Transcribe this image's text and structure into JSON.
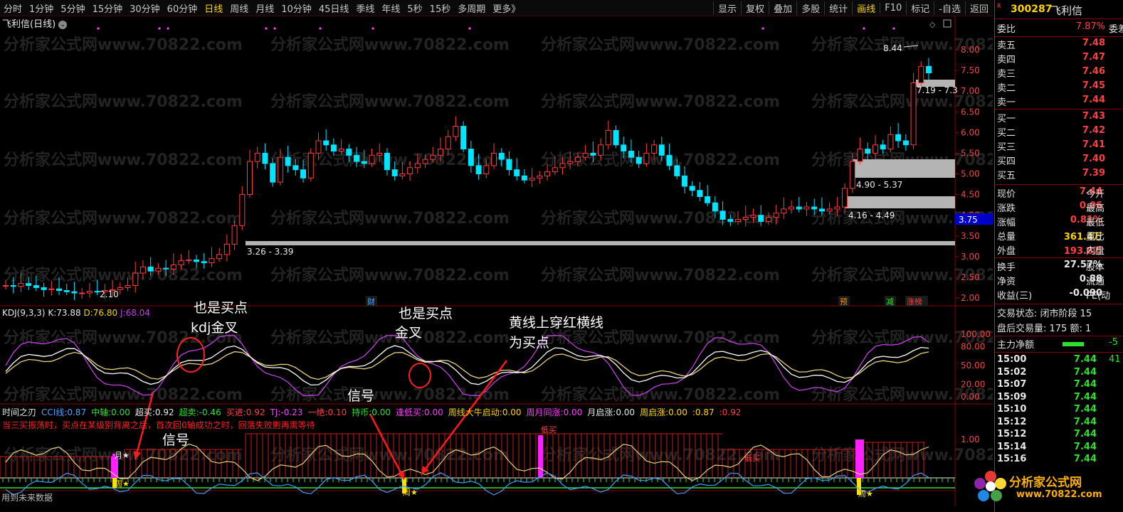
{
  "toolbar": {
    "periods": [
      "分时",
      "1分钟",
      "5分钟",
      "15分钟",
      "30分钟",
      "60分钟",
      "日线",
      "周线",
      "月线",
      "10分钟",
      "45日线",
      "季线",
      "年线",
      "5秒",
      "15秒",
      "多周期",
      "更多》"
    ],
    "active_period": "日线",
    "tools": [
      "显示",
      "复权",
      "叠加",
      "多股",
      "统计",
      "画线",
      "F10",
      "标记",
      "-自选",
      "返回"
    ],
    "active_tool": "画线"
  },
  "stock": {
    "code": "300287",
    "name": "飞利信",
    "title": "飞利信(日线)",
    "r_badge": "R"
  },
  "price_axis": [
    "8.00",
    "7.50",
    "7.00",
    "6.50",
    "6.00",
    "5.50",
    "5.00",
    "4.50",
    "4.00",
    "3.50",
    "3.00",
    "2.50",
    "2.00"
  ],
  "price_marks": {
    "high": "8.44",
    "low": "2.10",
    "current_tag": "3.75"
  },
  "zones": [
    "7.19 - 7.3",
    "4.90 - 5.37",
    "4.16 - 4.49",
    "3.26 - 3.39"
  ],
  "event_tags": [
    {
      "text": "财",
      "color": "#4da3ff"
    },
    {
      "text": "预",
      "color": "#ff8c00"
    },
    {
      "text": "减",
      "color": "#30e030"
    },
    {
      "text": "涨榜",
      "color": "#ff4040"
    }
  ],
  "watermark": "分析家公式网www.70822.com",
  "kdj": {
    "name": "KDJ(9,3,3)",
    "k_label": "K:",
    "k": "73.88",
    "d_label": "D:",
    "d": "76.80",
    "j_label": "J:",
    "j": "68.04",
    "axis": [
      "100.00",
      "80.00",
      "50.00",
      "20.00",
      "0.00"
    ]
  },
  "ind3": {
    "name": "时间之刃",
    "items": [
      {
        "label": "CCI线:",
        "value": "0.87",
        "color": "#4da3ff"
      },
      {
        "label": "中轴:",
        "value": "0.00",
        "color": "#30e030"
      },
      {
        "label": "超买:",
        "value": "0.92",
        "color": "#e8e8e8"
      },
      {
        "label": "超卖:",
        "value": "-0.46",
        "color": "#30e030"
      },
      {
        "label": "买进:",
        "value": "0.92",
        "color": "#ff4040"
      },
      {
        "label": "TJ:",
        "value": "-0.23",
        "color": "#ff40ff"
      },
      {
        "label": "一绝:",
        "value": "0.10",
        "color": "#ff4040"
      },
      {
        "label": "持币:",
        "value": "0.00",
        "color": "#30e030"
      },
      {
        "label": "逢低买:",
        "value": "0.00",
        "color": "#ff40ff"
      },
      {
        "label": "周线大牛启动:",
        "value": "0.00",
        "color": "#ffd400"
      },
      {
        "label": "周月同涨:",
        "value": "0.00",
        "color": "#ff40ff"
      },
      {
        "label": "月启涨:",
        "value": "0.00",
        "color": "#e8e8e8"
      },
      {
        "label": "周启涨:",
        "value": "0.00",
        "color": "#ffd400"
      },
      {
        "label": ":",
        "value": "0.87",
        "color": "#ffd400"
      },
      {
        "label": ":",
        "value": "0.92",
        "color": "#ff4040"
      }
    ],
    "note": "当三买振荡时，买点在某级别背离之后，首次回0轴成功之时，回落失败则再需等待",
    "axis": [
      "1.00"
    ],
    "chart_marks": {
      "low_buy_1": "低买",
      "low_buy_2": "低买",
      "week": "周★",
      "month": "月★"
    },
    "footer": "用到未来数据"
  },
  "annotations": {
    "kdj_cross_1": "也是买点",
    "kdj_cross_1b": "kdj金叉",
    "kdj_cross_2": "也是买点",
    "kdj_cross_2b": "金叉",
    "yellow_cross": "黄线上穿红横线",
    "yellow_cross_b": "为买点",
    "signal_1": "信号",
    "signal_2": "信号"
  },
  "quote": {
    "weibi_label": "委比",
    "weibi": "7.87%",
    "weibi_x": "委差",
    "sells": [
      {
        "label": "卖五",
        "price": "7.48"
      },
      {
        "label": "卖四",
        "price": "7.47"
      },
      {
        "label": "卖三",
        "price": "7.46"
      },
      {
        "label": "卖二",
        "price": "7.45"
      },
      {
        "label": "卖一",
        "price": "7.44"
      }
    ],
    "buys": [
      {
        "label": "买一",
        "price": "7.43"
      },
      {
        "label": "买二",
        "price": "7.42"
      },
      {
        "label": "买三",
        "price": "7.41"
      },
      {
        "label": "买四",
        "price": "7.40"
      },
      {
        "label": "买五",
        "price": "7.39"
      }
    ],
    "stats": [
      {
        "label": "现价",
        "value": "7.44",
        "x": "今开",
        "color": "#ff4040"
      },
      {
        "label": "涨跌",
        "value": "0.06",
        "x": "最高",
        "color": "#ff4040"
      },
      {
        "label": "涨幅",
        "value": "0.81%",
        "x": "最低",
        "color": "#ff4040"
      },
      {
        "label": "总量",
        "value": "361.4万",
        "x": "量比",
        "color": "#ffd400"
      },
      {
        "label": "外盘",
        "value": "193.8万",
        "x": "内盘",
        "color": "#ff4040"
      }
    ],
    "stats2": [
      {
        "label": "换手",
        "value": "27.57%",
        "x": "股本"
      },
      {
        "label": "净资",
        "value": "0.88",
        "x": "流通"
      },
      {
        "label": "收益(三)",
        "value": "-0.090",
        "x": "PE(动"
      }
    ],
    "trade_state": "交易状态: 闭市阶段 15",
    "after_hours": "盘后交易量: 175  额: 1",
    "net_label": "主力净额",
    "net_value": "-5",
    "ticks": [
      {
        "time": "15:00",
        "price": "7.44",
        "vol": "41"
      },
      {
        "time": "15:02",
        "price": "7.44",
        "vol": ""
      },
      {
        "time": "15:07",
        "price": "7.44",
        "vol": ""
      },
      {
        "time": "15:09",
        "price": "7.44",
        "vol": ""
      },
      {
        "time": "15:10",
        "price": "7.44",
        "vol": ""
      },
      {
        "time": "15:12",
        "price": "7.44",
        "vol": ""
      },
      {
        "time": "15:12",
        "price": "7.44",
        "vol": ""
      },
      {
        "time": "15:14",
        "price": "7.44",
        "vol": ""
      },
      {
        "time": "15:16",
        "price": "7.44",
        "vol": ""
      }
    ]
  },
  "brand": {
    "name": "分析家公式网",
    "url": "www.70822.com"
  },
  "colors": {
    "up": "#ff3c3c",
    "down": "#00e5ff",
    "k": "#ffffff",
    "d": "#e8d27a",
    "j": "#c040e0",
    "zone": "#b4b4b4"
  }
}
